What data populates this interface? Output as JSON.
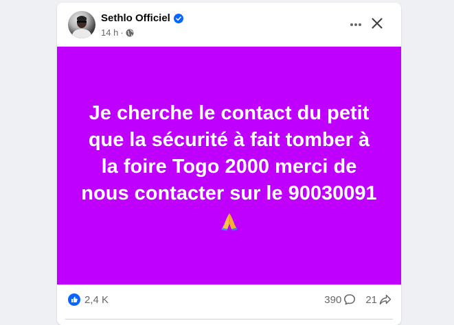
{
  "post": {
    "author": "Sethlo Officiel",
    "time": "14 h",
    "dot": "·",
    "text": "Je cherche le contact du petit\nque la sécurité à fait tomber à\nla foire Togo 2000 merci de\nnous contacter sur le 90030091",
    "emoji_icon": "folded-hands-icon",
    "background_color": "#c000ff"
  },
  "footer": {
    "reactions_count": "2,4 K",
    "comments_count": "390",
    "shares_count": "21"
  },
  "icons": {
    "verified": "verified-badge-icon",
    "audience": "globe-icon",
    "more": "more-horizontal-icon",
    "close": "close-icon",
    "like": "like-icon",
    "comment": "comment-icon",
    "share": "share-icon"
  },
  "colors": {
    "accent": "#0866ff",
    "muted": "#65676b",
    "post_bg": "#c000ff"
  }
}
